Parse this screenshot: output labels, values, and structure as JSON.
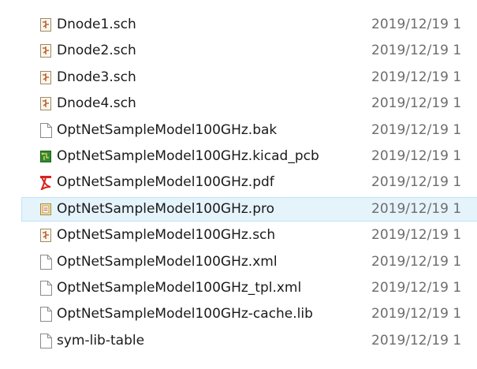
{
  "files": [
    {
      "name": "Dnode1.sch",
      "date": "2019/12/19 1",
      "icon": "schematic-icon",
      "selected": false
    },
    {
      "name": "Dnode2.sch",
      "date": "2019/12/19 1",
      "icon": "schematic-icon",
      "selected": false
    },
    {
      "name": "Dnode3.sch",
      "date": "2019/12/19 1",
      "icon": "schematic-icon",
      "selected": false
    },
    {
      "name": "Dnode4.sch",
      "date": "2019/12/19 1",
      "icon": "schematic-icon",
      "selected": false
    },
    {
      "name": "OptNetSampleModel100GHz.bak",
      "date": "2019/12/19 1",
      "icon": "blank-file-icon",
      "selected": false
    },
    {
      "name": "OptNetSampleModel100GHz.kicad_pcb",
      "date": "2019/12/19 1",
      "icon": "pcb-file-icon",
      "selected": false
    },
    {
      "name": "OptNetSampleModel100GHz.pdf",
      "date": "2019/12/19 1",
      "icon": "pdf-file-icon",
      "selected": false
    },
    {
      "name": "OptNetSampleModel100GHz.pro",
      "date": "2019/12/19 1",
      "icon": "project-file-icon",
      "selected": true
    },
    {
      "name": "OptNetSampleModel100GHz.sch",
      "date": "2019/12/19 1",
      "icon": "schematic-icon",
      "selected": false
    },
    {
      "name": "OptNetSampleModel100GHz.xml",
      "date": "2019/12/19 1",
      "icon": "blank-file-icon",
      "selected": false
    },
    {
      "name": "OptNetSampleModel100GHz_tpl.xml",
      "date": "2019/12/19 1",
      "icon": "blank-file-icon",
      "selected": false
    },
    {
      "name": "OptNetSampleModel100GHz-cache.lib",
      "date": "2019/12/19 1",
      "icon": "blank-file-icon",
      "selected": false
    },
    {
      "name": "sym-lib-table",
      "date": "2019/12/19 1",
      "icon": "blank-file-icon",
      "selected": false
    }
  ],
  "colors": {
    "selection_bg": "#e5f3fb",
    "selection_border": "#bfe3f7",
    "name_text": "#1a1a1a",
    "date_text": "#6d6d6d"
  }
}
